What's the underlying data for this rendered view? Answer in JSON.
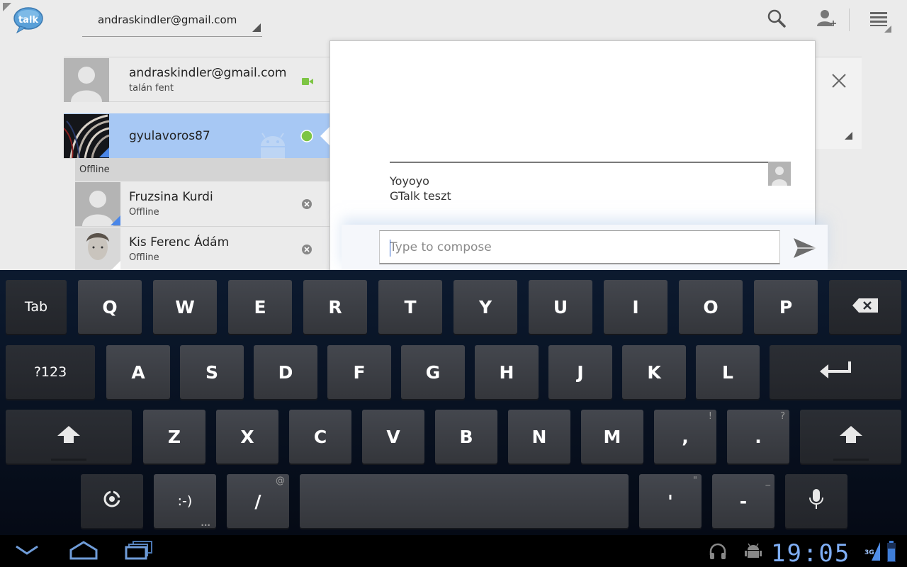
{
  "app": {
    "logo_text": "talk",
    "account": "andraskindler@gmail.com"
  },
  "contacts": {
    "self": {
      "name": "andraskindler@gmail.com",
      "status": "talán fent"
    },
    "selected": {
      "name": "gyulavoros87"
    },
    "offline_header": "Offline",
    "offline": [
      {
        "name": "Fruzsina Kurdi",
        "status": "Offline"
      },
      {
        "name": "Kis Ferenc Ádám",
        "status": "Offline"
      }
    ]
  },
  "chat": {
    "messages": [
      "Yoyoyo",
      "GTalk teszt"
    ],
    "compose_placeholder": "Type to compose"
  },
  "keyboard": {
    "row1": [
      "Tab",
      "Q",
      "W",
      "E",
      "R",
      "T",
      "Y",
      "U",
      "I",
      "O",
      "P"
    ],
    "row2": [
      "?123",
      "A",
      "S",
      "D",
      "F",
      "G",
      "H",
      "J",
      "K",
      "L"
    ],
    "row3": [
      "Z",
      "X",
      "C",
      "V",
      "B",
      "N",
      "M",
      ",",
      "."
    ],
    "row3_hints": [
      "!",
      "?"
    ],
    "row4": [
      ":-)",
      "/",
      "'",
      "-"
    ],
    "row4_hints": [
      "@",
      "\"",
      "_"
    ],
    "smiley_dots": "..."
  },
  "status": {
    "clock": "19:05",
    "network": "3G"
  },
  "colors": {
    "selected_row": "#a7c8f4",
    "online_green": "#7dc544",
    "clock_blue": "#7faef5"
  }
}
